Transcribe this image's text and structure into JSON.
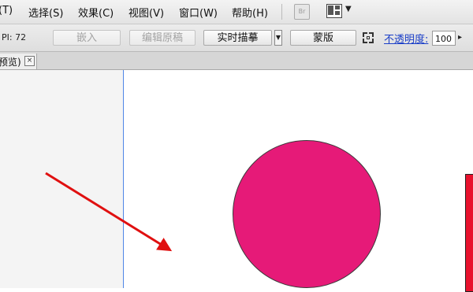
{
  "menubar": {
    "items": [
      "(T)",
      "选择(S)",
      "效果(C)",
      "视图(V)",
      "窗口(W)",
      "帮助(H)"
    ],
    "bridge_icon_label": "Br"
  },
  "control_bar": {
    "ppi": "PI: 72",
    "embed_label": "嵌入",
    "edit_original_label": "编辑原稿",
    "live_trace_label": "实时描摹",
    "mask_label": "蒙版",
    "opacity_label": "不透明度:",
    "opacity_value": "100"
  },
  "tabs": [
    {
      "label": "预览)",
      "close_symbol": "×"
    }
  ],
  "colors": {
    "circle_fill": "#e61a78",
    "rect_fill": "#e8112d",
    "arrow": "#e01010",
    "guide": "#4f86e6"
  }
}
